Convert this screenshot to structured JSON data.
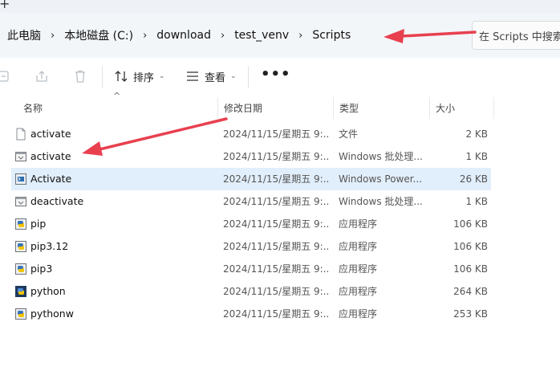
{
  "window": {
    "new_tab_glyph": "+"
  },
  "address": {
    "crumbs": [
      "此电脑",
      "本地磁盘 (C:)",
      "download",
      "test_venv",
      "Scripts"
    ],
    "search_placeholder": "在 Scripts 中搜索"
  },
  "toolbar": {
    "sort_label": "排序",
    "view_label": "查看",
    "more_label": "•••",
    "icons": [
      "share-icon",
      "export-icon",
      "delete-icon",
      "sort-icon",
      "view-icon",
      "more-icon"
    ]
  },
  "columns": {
    "name": "名称",
    "date": "修改日期",
    "type": "类型",
    "size": "大小"
  },
  "files": [
    {
      "name": "activate",
      "date": "2024/11/15/星期五 9:...",
      "type": "文件",
      "size": "2 KB",
      "icon": "blank-file-icon"
    },
    {
      "name": "activate",
      "date": "2024/11/15/星期五 9:...",
      "type": "Windows 批处理...",
      "size": "1 KB",
      "icon": "batch-file-icon"
    },
    {
      "name": "Activate",
      "date": "2024/11/15/星期五 9:...",
      "type": "Windows Power...",
      "size": "26 KB",
      "icon": "powershell-file-icon"
    },
    {
      "name": "deactivate",
      "date": "2024/11/15/星期五 9:...",
      "type": "Windows 批处理...",
      "size": "1 KB",
      "icon": "batch-file-icon"
    },
    {
      "name": "pip",
      "date": "2024/11/15/星期五 9:...",
      "type": "应用程序",
      "size": "106 KB",
      "icon": "exe-icon"
    },
    {
      "name": "pip3.12",
      "date": "2024/11/15/星期五 9:...",
      "type": "应用程序",
      "size": "106 KB",
      "icon": "exe-icon"
    },
    {
      "name": "pip3",
      "date": "2024/11/15/星期五 9:...",
      "type": "应用程序",
      "size": "106 KB",
      "icon": "exe-icon"
    },
    {
      "name": "python",
      "date": "2024/11/15/星期五 9:...",
      "type": "应用程序",
      "size": "264 KB",
      "icon": "python-exe-icon"
    },
    {
      "name": "pythonw",
      "date": "2024/11/15/星期五 9:...",
      "type": "应用程序",
      "size": "253 KB",
      "icon": "python-exe-icon"
    }
  ],
  "selected_row": 2,
  "colors": {
    "selection": "#e1eefb",
    "annotation_arrow": "#e8404f",
    "address_bg": "#f3f6f9"
  }
}
